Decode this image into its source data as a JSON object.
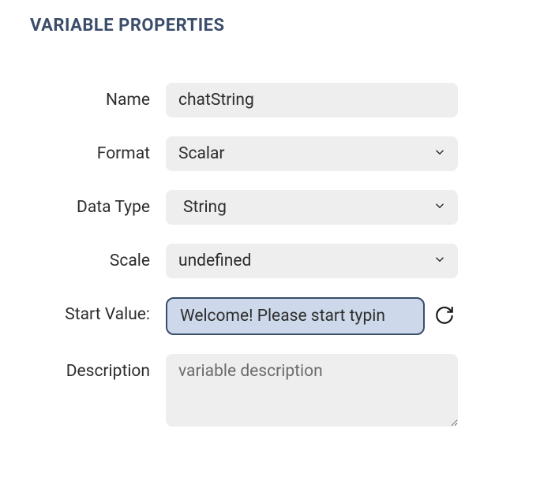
{
  "panel": {
    "title": "VARIABLE PROPERTIES"
  },
  "fields": {
    "name": {
      "label": "Name",
      "value": "chatString"
    },
    "format": {
      "label": "Format",
      "value": "Scalar"
    },
    "data_type": {
      "label": "Data Type",
      "value": "String"
    },
    "scale": {
      "label": "Scale",
      "value": "undefined"
    },
    "start_value": {
      "label": "Start Value:",
      "value": "Welcome! Please start typin"
    },
    "description": {
      "label": "Description",
      "value": "",
      "placeholder": "variable description"
    }
  }
}
